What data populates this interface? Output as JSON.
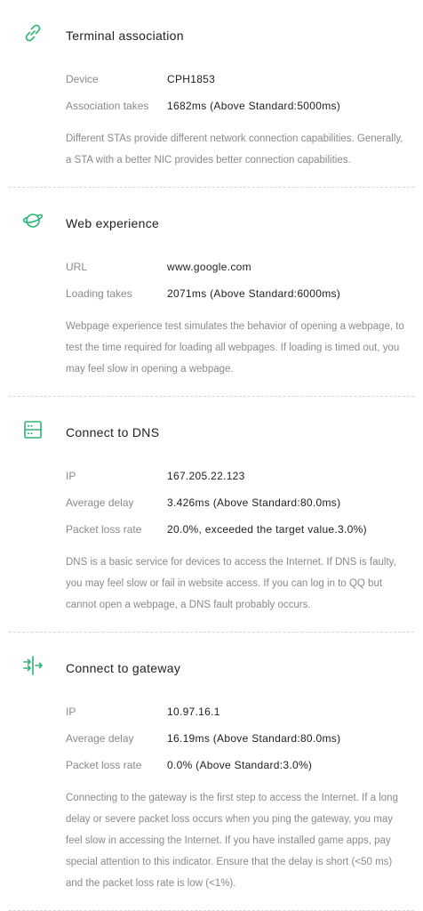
{
  "accent_color": "#2bb673",
  "sections": [
    {
      "title": "Terminal association",
      "icon": "link-icon",
      "rows": [
        {
          "label": "Device",
          "value": "CPH1853"
        },
        {
          "label": "Association takes",
          "value": "1682ms (Above Standard:5000ms)"
        }
      ],
      "description": "Different STAs provide different network connection capabilities. Generally, a STA with a better NIC provides better connection capabilities."
    },
    {
      "title": "Web experience",
      "icon": "planet-icon",
      "rows": [
        {
          "label": "URL",
          "value": "www.google.com"
        },
        {
          "label": "Loading takes",
          "value": "2071ms (Above Standard:6000ms)"
        }
      ],
      "description": "Webpage experience test simulates the behavior of opening a webpage, to test the time required for loading all webpages. If loading is timed out, you may feel slow in opening a webpage."
    },
    {
      "title": "Connect to DNS",
      "icon": "server-icon",
      "rows": [
        {
          "label": "IP",
          "value": "167.205.22.123"
        },
        {
          "label": "Average delay",
          "value": "3.426ms (Above Standard:80.0ms)"
        },
        {
          "label": "Packet loss rate",
          "value": "20.0%, exceeded the target value.3.0%)"
        }
      ],
      "description": "DNS is a basic service for devices to access the Internet. If DNS is faulty, you may feel slow or fail in website access. If you can log in to QQ but cannot open a webpage, a DNS fault probably occurs."
    },
    {
      "title": "Connect to gateway",
      "icon": "gateway-icon",
      "rows": [
        {
          "label": "IP",
          "value": "10.97.16.1"
        },
        {
          "label": "Average delay",
          "value": "16.19ms (Above Standard:80.0ms)"
        },
        {
          "label": "Packet loss rate",
          "value": "0.0% (Above Standard:3.0%)"
        }
      ],
      "description": "Connecting to the gateway is the first step to access the Internet. If a long delay or severe packet loss occurs when you ping the gateway, you may feel slow in accessing the Internet. If you have installed game apps, pay special attention to this indicator. Ensure that the delay is short (<50 ms) and the packet loss rate is low (<1%)."
    }
  ]
}
